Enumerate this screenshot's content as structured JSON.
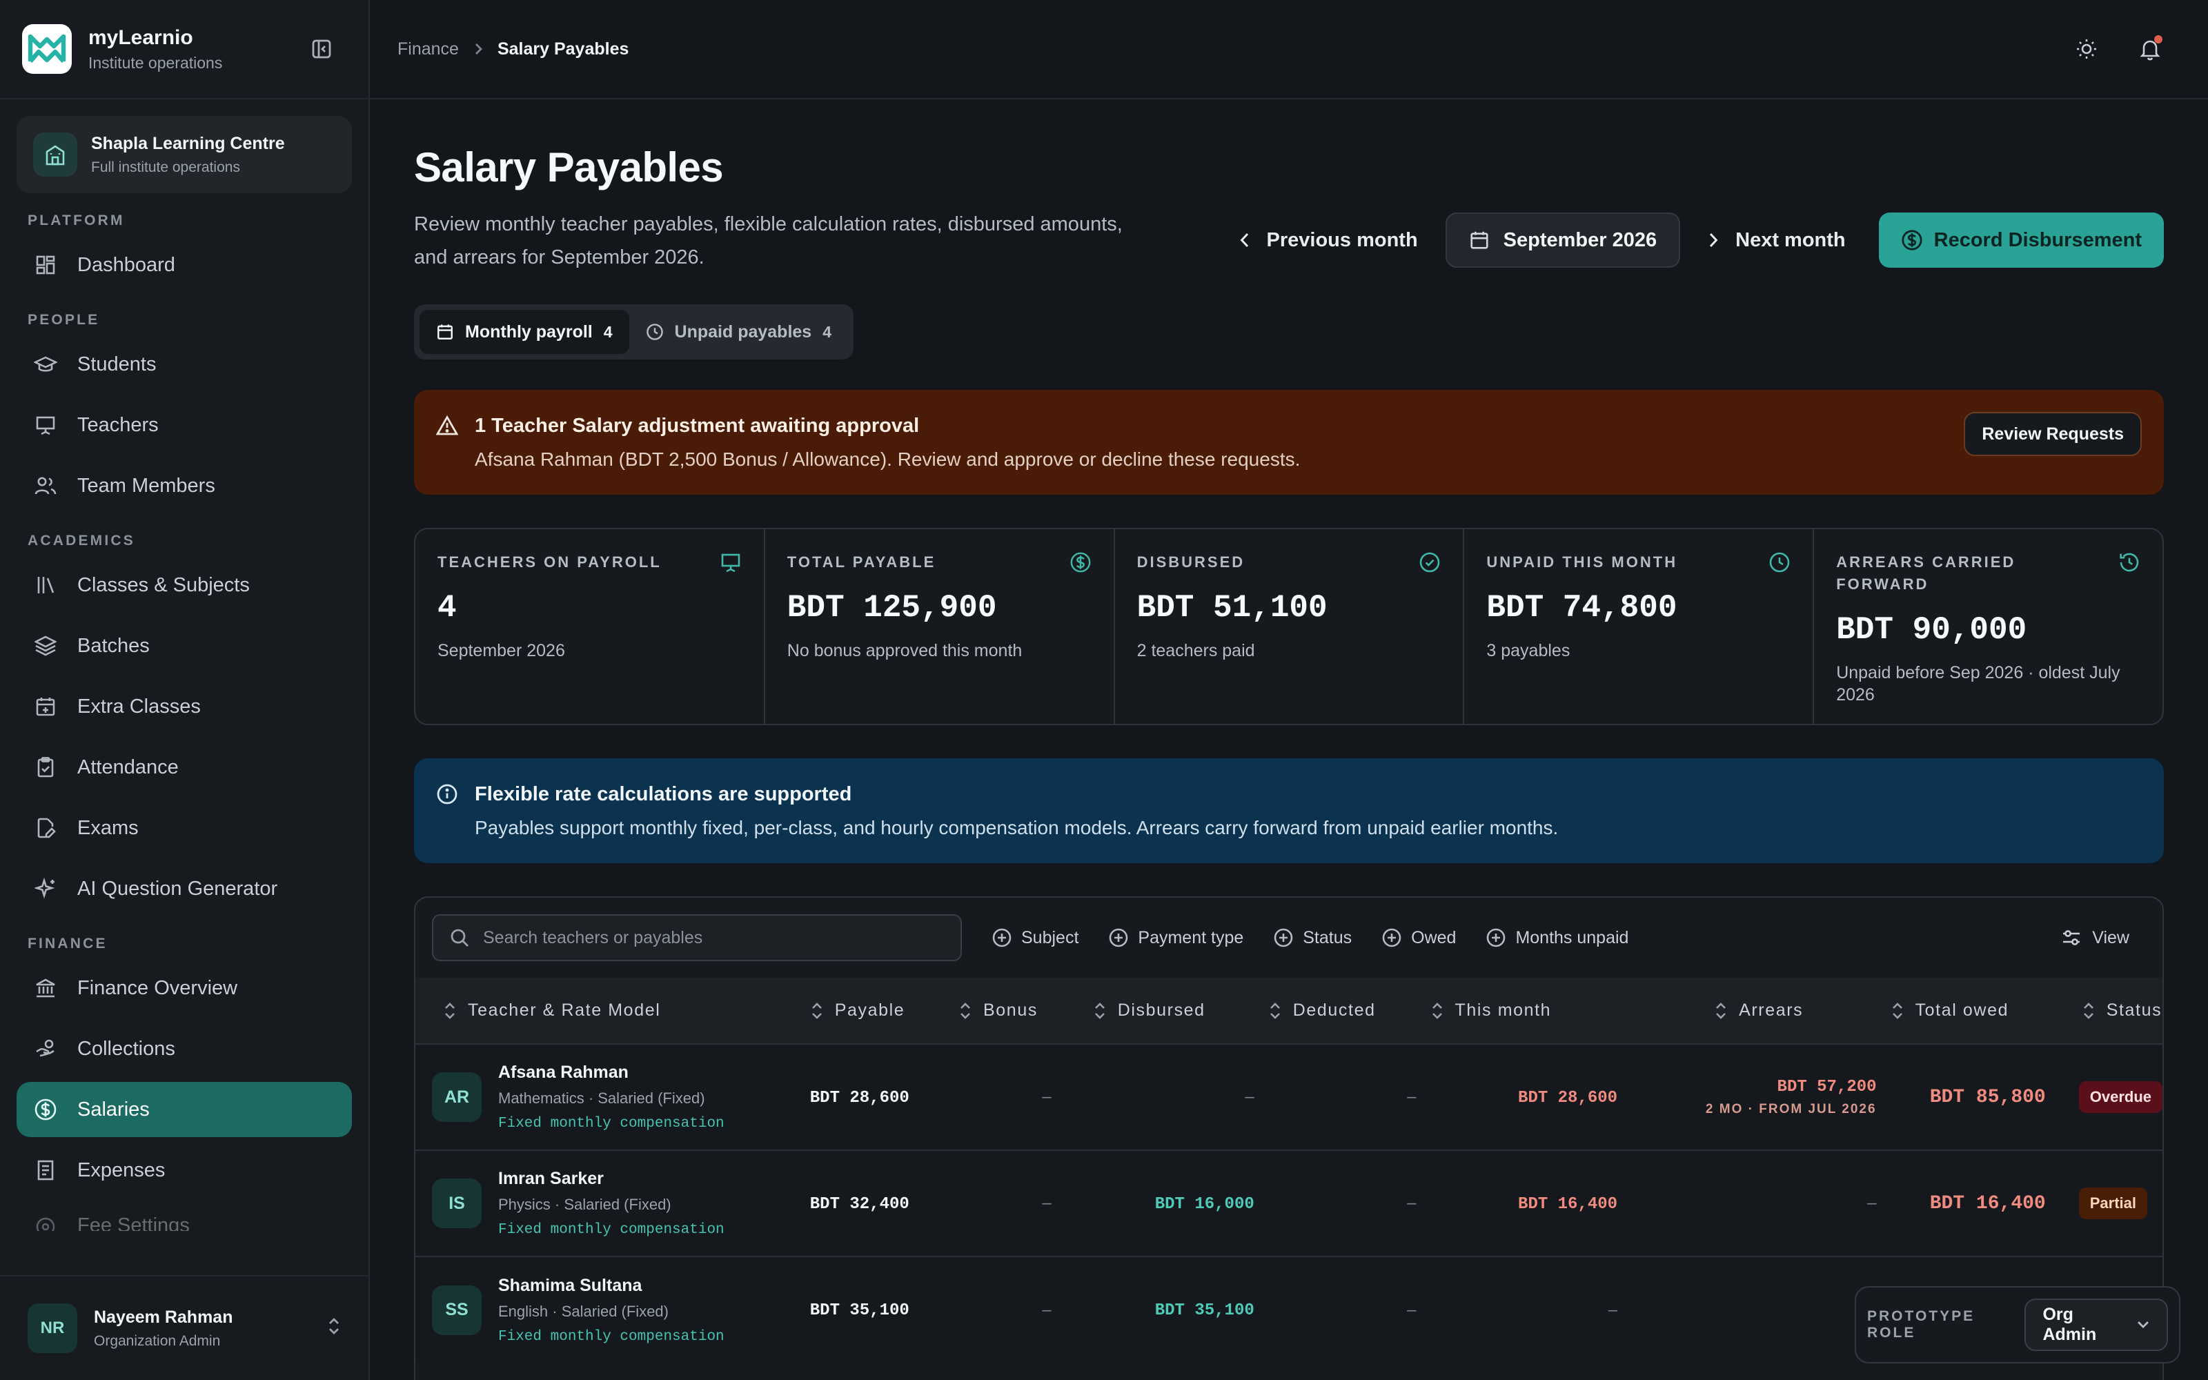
{
  "brand": {
    "name": "myLearnio",
    "subtitle": "Institute operations"
  },
  "org": {
    "name": "Shapla Learning Centre",
    "subtitle": "Full institute operations"
  },
  "sidebar": {
    "sections": [
      {
        "label": "PLATFORM",
        "items": [
          {
            "label": "Dashboard",
            "icon": "dashboard-icon"
          }
        ]
      },
      {
        "label": "PEOPLE",
        "items": [
          {
            "label": "Students",
            "icon": "graduation-cap-icon"
          },
          {
            "label": "Teachers",
            "icon": "presentation-icon"
          },
          {
            "label": "Team Members",
            "icon": "users-icon"
          }
        ]
      },
      {
        "label": "ACADEMICS",
        "items": [
          {
            "label": "Classes & Subjects",
            "icon": "library-icon"
          },
          {
            "label": "Batches",
            "icon": "layers-icon"
          },
          {
            "label": "Extra Classes",
            "icon": "calendar-plus-icon"
          },
          {
            "label": "Attendance",
            "icon": "clipboard-check-icon"
          },
          {
            "label": "Exams",
            "icon": "file-pen-icon"
          },
          {
            "label": "AI Question Generator",
            "icon": "sparkles-icon"
          }
        ]
      },
      {
        "label": "FINANCE",
        "items": [
          {
            "label": "Finance Overview",
            "icon": "bank-icon"
          },
          {
            "label": "Collections",
            "icon": "hand-coins-icon"
          },
          {
            "label": "Salaries",
            "icon": "dollar-circle-icon",
            "active": true
          },
          {
            "label": "Expenses",
            "icon": "receipt-icon"
          },
          {
            "label": "Fee Settings",
            "icon": "settings-icon",
            "faded": true
          }
        ]
      }
    ]
  },
  "user": {
    "initials": "NR",
    "name": "Nayeem Rahman",
    "role": "Organization Admin"
  },
  "breadcrumb": {
    "parent": "Finance",
    "current": "Salary Payables"
  },
  "page": {
    "title": "Salary Payables",
    "description": "Review monthly teacher payables, flexible calculation rates, disbursed amounts, and arrears for September 2026."
  },
  "month_nav": {
    "prev": "Previous month",
    "current": "September 2026",
    "next": "Next month"
  },
  "record_button": "Record Disbursement",
  "tabs": [
    {
      "label": "Monthly payroll",
      "count": "4",
      "active": true
    },
    {
      "label": "Unpaid payables",
      "count": "4",
      "active": false
    }
  ],
  "approval_alert": {
    "title": "1 Teacher Salary adjustment awaiting approval",
    "text": "Afsana Rahman (BDT 2,500 Bonus / Allowance). Review and approve or decline these requests.",
    "button": "Review Requests"
  },
  "stats": [
    {
      "label": "TEACHERS ON PAYROLL",
      "value": "4",
      "sub": "September 2026",
      "icon": "presentation-icon"
    },
    {
      "label": "TOTAL PAYABLE",
      "value": "BDT 125,900",
      "sub": "No bonus approved this month",
      "icon": "dollar-circle-icon"
    },
    {
      "label": "DISBURSED",
      "value": "BDT 51,100",
      "sub": "2 teachers paid",
      "icon": "check-circle-icon"
    },
    {
      "label": "UNPAID THIS MONTH",
      "value": "BDT 74,800",
      "sub": "3 payables",
      "icon": "clock-icon"
    },
    {
      "label": "ARREARS CARRIED FORWARD",
      "value": "BDT 90,000",
      "sub": "Unpaid before Sep 2026 · oldest July 2026",
      "icon": "history-icon"
    }
  ],
  "info_alert": {
    "title": "Flexible rate calculations are supported",
    "text": "Payables support monthly fixed, per-class, and hourly compensation models. Arrears carry forward from unpaid earlier months."
  },
  "table": {
    "search_placeholder": "Search teachers or payables",
    "filters": [
      "Subject",
      "Payment type",
      "Status",
      "Owed",
      "Months unpaid"
    ],
    "view_label": "View",
    "columns": [
      "Teacher & Rate Model",
      "Payable",
      "Bonus",
      "Disbursed",
      "Deducted",
      "This month",
      "Arrears",
      "Total owed",
      "Status"
    ],
    "rows": [
      {
        "initials": "AR",
        "name": "Afsana Rahman",
        "subject": "Mathematics · Salaried (Fixed)",
        "rate": "Fixed monthly compensation",
        "payable": "BDT 28,600",
        "bonus": "–",
        "disbursed": "–",
        "deducted": "–",
        "this_month": "BDT 28,600",
        "arrears": "BDT 57,200",
        "arrears_note": "2 MO · FROM JUL 2026",
        "total_owed": "BDT 85,800",
        "status": "Overdue"
      },
      {
        "initials": "IS",
        "name": "Imran Sarker",
        "subject": "Physics · Salaried (Fixed)",
        "rate": "Fixed monthly compensation",
        "payable": "BDT 32,400",
        "bonus": "–",
        "disbursed": "BDT 16,000",
        "deducted": "–",
        "this_month": "BDT 16,400",
        "arrears": "–",
        "arrears_note": "",
        "total_owed": "BDT 16,400",
        "status": "Partial"
      },
      {
        "initials": "SS",
        "name": "Shamima Sultana",
        "subject": "English · Salaried (Fixed)",
        "rate": "Fixed monthly compensation",
        "payable": "BDT 35,100",
        "bonus": "–",
        "disbursed": "BDT 35,100",
        "deducted": "–",
        "this_month": "–",
        "arrears": "–",
        "arrears_note": "",
        "total_owed": "",
        "status": ""
      }
    ]
  },
  "prototype": {
    "label": "PROTOTYPE ROLE",
    "value": "Org Admin"
  },
  "colors": {
    "accent": "#2aa396",
    "active_nav": "#1b6b63",
    "warning_bg": "#4a1c07",
    "info_bg": "#0b3350",
    "danger_text": "#f08b80"
  }
}
